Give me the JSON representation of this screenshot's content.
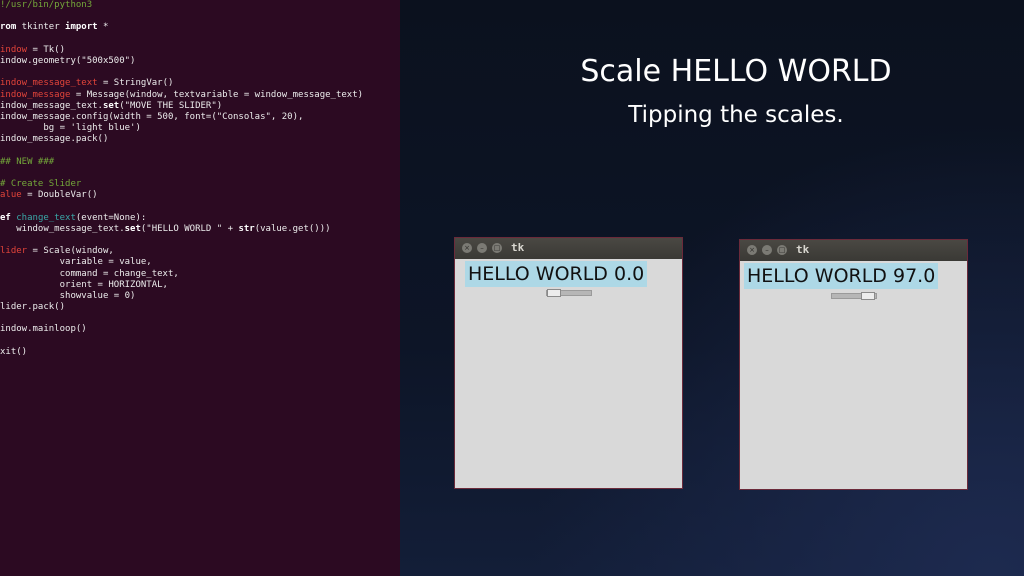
{
  "editor": {
    "lines": [
      [
        {
          "t": "cmt",
          "s": "!/usr/bin/python3"
        }
      ],
      [
        {
          "t": "plain",
          "s": ""
        }
      ],
      [
        {
          "t": "kw",
          "s": "rom"
        },
        {
          "t": "plain",
          "s": " tkinter "
        },
        {
          "t": "kw",
          "s": "import"
        },
        {
          "t": "plain",
          "s": " *"
        }
      ],
      [
        {
          "t": "plain",
          "s": ""
        }
      ],
      [
        {
          "t": "var",
          "s": "indow"
        },
        {
          "t": "plain",
          "s": " = Tk()"
        }
      ],
      [
        {
          "t": "plain",
          "s": "indow.geometry(\"500x500\")"
        }
      ],
      [
        {
          "t": "plain",
          "s": ""
        }
      ],
      [
        {
          "t": "var",
          "s": "indow_message_text"
        },
        {
          "t": "plain",
          "s": " = StringVar()"
        }
      ],
      [
        {
          "t": "var",
          "s": "indow_message"
        },
        {
          "t": "plain",
          "s": " = Message(window, textvariable = window_message_text)"
        }
      ],
      [
        {
          "t": "plain",
          "s": "indow_message_text."
        },
        {
          "t": "kw",
          "s": "set"
        },
        {
          "t": "plain",
          "s": "(\"MOVE THE SLIDER\")"
        }
      ],
      [
        {
          "t": "plain",
          "s": "indow_message.config(width = 500, font=(\"Consolas\", 20),"
        }
      ],
      [
        {
          "t": "plain",
          "s": "        bg = 'light blue')"
        }
      ],
      [
        {
          "t": "plain",
          "s": "indow_message.pack()"
        }
      ],
      [
        {
          "t": "plain",
          "s": ""
        }
      ],
      [
        {
          "t": "cmt",
          "s": "## NEW ###"
        }
      ],
      [
        {
          "t": "plain",
          "s": ""
        }
      ],
      [
        {
          "t": "cmt",
          "s": "# Create Slider"
        }
      ],
      [
        {
          "t": "var",
          "s": "alue"
        },
        {
          "t": "plain",
          "s": " = DoubleVar()"
        }
      ],
      [
        {
          "t": "plain",
          "s": ""
        }
      ],
      [
        {
          "t": "kw",
          "s": "ef"
        },
        {
          "t": "plain",
          "s": " "
        },
        {
          "t": "fn",
          "s": "change_text"
        },
        {
          "t": "plain",
          "s": "(event=None):"
        }
      ],
      [
        {
          "t": "plain",
          "s": "   window_message_text."
        },
        {
          "t": "kw",
          "s": "set"
        },
        {
          "t": "plain",
          "s": "(\"HELLO WORLD \" + "
        },
        {
          "t": "kw",
          "s": "str"
        },
        {
          "t": "plain",
          "s": "(value.get()))"
        }
      ],
      [
        {
          "t": "plain",
          "s": ""
        }
      ],
      [
        {
          "t": "var",
          "s": "lider"
        },
        {
          "t": "plain",
          "s": " = Scale(window,"
        }
      ],
      [
        {
          "t": "plain",
          "s": "           variable = value,"
        }
      ],
      [
        {
          "t": "plain",
          "s": "           command = change_text,"
        }
      ],
      [
        {
          "t": "plain",
          "s": "           orient = HORIZONTAL,"
        }
      ],
      [
        {
          "t": "plain",
          "s": "           showvalue = 0)"
        }
      ],
      [
        {
          "t": "plain",
          "s": "lider.pack()"
        }
      ],
      [
        {
          "t": "plain",
          "s": ""
        }
      ],
      [
        {
          "t": "plain",
          "s": "indow.mainloop()"
        }
      ],
      [
        {
          "t": "plain",
          "s": ""
        }
      ],
      [
        {
          "t": "plain",
          "s": "xit()"
        }
      ]
    ]
  },
  "slide": {
    "title": "Scale HELLO WORLD",
    "subtitle": "Tipping the scales."
  },
  "windows": [
    {
      "title": "tk",
      "message": "HELLO WORLD 0.0",
      "slider_fraction": 0.0,
      "buttons": [
        "×",
        "–",
        "□"
      ]
    },
    {
      "title": "tk",
      "message": "HELLO WORLD 97.0",
      "slider_fraction": 0.97,
      "buttons": [
        "×",
        "–",
        "□"
      ]
    }
  ],
  "colors": {
    "editor_bg": "#2c0a22",
    "message_bg": "#add8e6",
    "window_bg": "#d9d9d9"
  }
}
